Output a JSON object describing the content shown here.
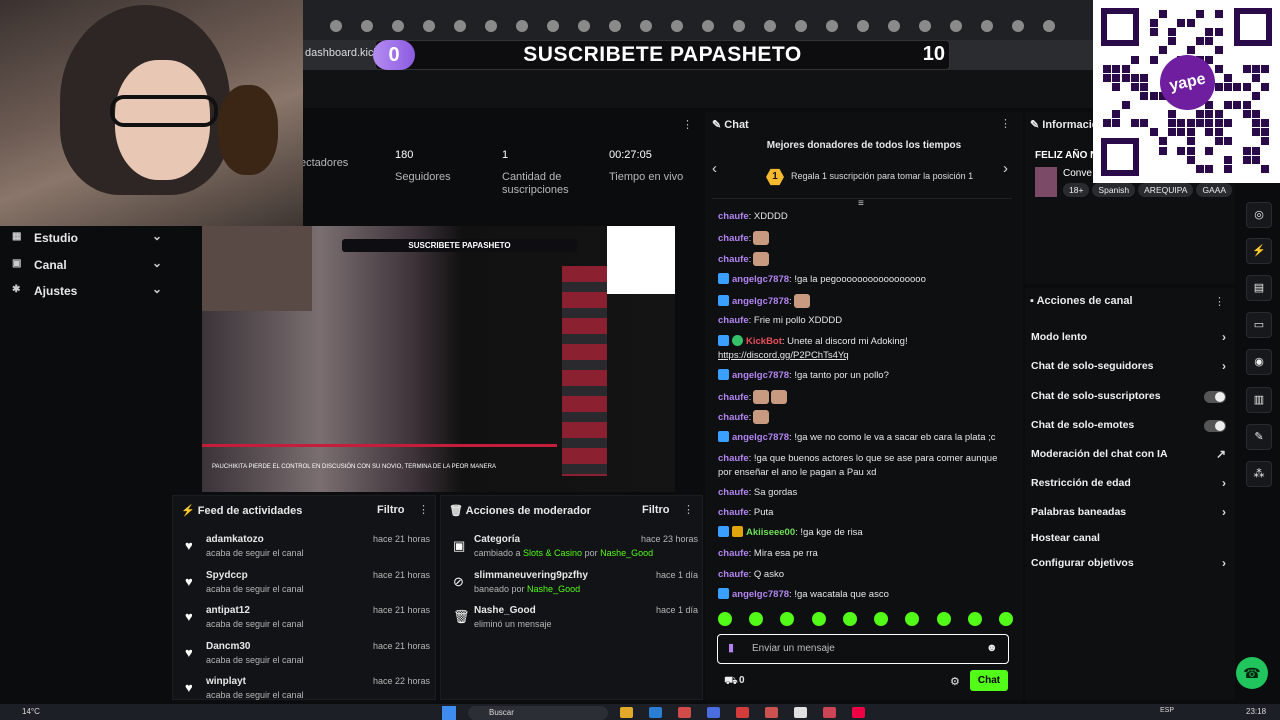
{
  "browser": {
    "url": "dashboard.kick.",
    "banner_count": "0",
    "banner_text": "SUSCRIBETE PAPASHETO",
    "banner_goal": "10"
  },
  "stats": [
    {
      "value": "",
      "label": "ectadores"
    },
    {
      "value": "180",
      "label": "Seguidores"
    },
    {
      "value": "1",
      "label": "Cantidad de suscripciones"
    },
    {
      "value": "00:27:05",
      "label": "Tiempo en vivo"
    }
  ],
  "sidebar": {
    "items": [
      {
        "label": "Estudio"
      },
      {
        "label": "Canal"
      },
      {
        "label": "Ajustes"
      }
    ]
  },
  "player": {
    "mini_banner": "SUSCRIBETE PAPASHETO",
    "caption": "PAUCHIKITA PIERDE EL CONTROL EN DISCUSIÓN CON SU NOVIO, TERMINA DE LA PEOR MANERA"
  },
  "feed": {
    "title": "Feed de actividades",
    "filter": "Filtro",
    "items": [
      {
        "name": "adamkatozo",
        "sub": "acaba de seguir el canal",
        "time": "hace 21 horas"
      },
      {
        "name": "Spydccp",
        "sub": "acaba de seguir el canal",
        "time": "hace 21 horas"
      },
      {
        "name": "antipat12",
        "sub": "acaba de seguir el canal",
        "time": "hace 21 horas"
      },
      {
        "name": "Dancm30",
        "sub": "acaba de seguir el canal",
        "time": "hace 21 horas"
      },
      {
        "name": "winplayt",
        "sub": "acaba de seguir el canal",
        "time": "hace 22 horas"
      }
    ]
  },
  "moderator": {
    "title": "Acciones de moderador",
    "filter": "Filtro",
    "items": [
      {
        "name": "Categoría",
        "sub_prefix": "cambiado a ",
        "sub_hl": "Slots & Casino",
        "sub_mid": " por ",
        "sub_user": "Nashe_Good",
        "time": "hace 23 horas"
      },
      {
        "name": "slimmaneuvering9pzfhy",
        "sub_prefix": "baneado por ",
        "sub_hl": "",
        "sub_mid": "",
        "sub_user": "Nashe_Good",
        "time": "hace 1 día"
      },
      {
        "name": "Nashe_Good",
        "sub_prefix": "eliminó un mensaje",
        "sub_hl": "",
        "sub_mid": "",
        "sub_user": "",
        "time": "hace 1 día"
      }
    ]
  },
  "chat": {
    "title": "Chat",
    "donors_title": "Mejores donadores de todos los tiempos",
    "donor_rank": "1",
    "donor_text": "Regala 1 suscripción para tomar la posición 1",
    "messages": [
      {
        "user": "chaufe",
        "text": ": XDDDD"
      },
      {
        "user": "chaufe",
        "text": ":"
      },
      {
        "user": "chaufe",
        "text": ":"
      },
      {
        "user": "angelgc7878",
        "text": ": !ga la pegooooooooooooooooo"
      },
      {
        "user": "angelgc7878",
        "text": ":"
      },
      {
        "user": "chaufe",
        "text": ": Frie mi pollo XDDDD"
      },
      {
        "user": "KickBot",
        "text": ": Unete al discord mi Adoking!",
        "link": "https://discord.gg/P2PChTs4Yq"
      },
      {
        "user": "angelgc7878",
        "text": ": !ga tanto por un pollo?"
      },
      {
        "user": "chaufe",
        "text": ":"
      },
      {
        "user": "chaufe",
        "text": ":"
      },
      {
        "user": "angelgc7878",
        "text": ": !ga we no como le va a sacar eb cara la plata ;c"
      },
      {
        "user": "chaufe",
        "text": ": !ga que buenos actores lo que se ase para comer aunque por enseñar el ano le pagan a Pau xd"
      },
      {
        "user": "chaufe",
        "text": ": Sa gordas"
      },
      {
        "user": "chaufe",
        "text": ": Puta"
      },
      {
        "user": "Akiiseee00",
        "text": ": !ga kge de risa"
      },
      {
        "user": "chaufe",
        "text": ": Mira esa pe rra"
      },
      {
        "user": "chaufe",
        "text": ": Q asko"
      },
      {
        "user": "angelgc7878",
        "text": ": !ga wacatala que asco"
      }
    ],
    "input_placeholder": "Enviar un mensaje",
    "gift_count": "0",
    "send_label": "Chat"
  },
  "info": {
    "title": "Informació",
    "stream_title": "FELIZ AÑO N",
    "category": "Conve",
    "tags": [
      "18+",
      "Spanish",
      "AREQUIPA",
      "GAAA"
    ]
  },
  "channel_actions": {
    "title": "Acciones de canal",
    "items": [
      {
        "label": "Modo lento",
        "kind": "arrow"
      },
      {
        "label": "Chat de solo-seguidores",
        "kind": "arrow"
      },
      {
        "label": "Chat de solo-suscriptores",
        "kind": "toggle"
      },
      {
        "label": "Chat de solo-emotes",
        "kind": "toggle"
      },
      {
        "label": "Moderación del chat con IA",
        "kind": "external"
      },
      {
        "label": "Restricción de edad",
        "kind": "arrow"
      },
      {
        "label": "Palabras baneadas",
        "kind": "arrow"
      },
      {
        "label": "Hostear canal",
        "kind": "none"
      },
      {
        "label": "Configurar objetivos",
        "kind": "arrow"
      }
    ]
  },
  "overlay": {
    "yape": "yape"
  },
  "taskbar": {
    "weather": "14°C",
    "search": "Buscar",
    "lang": "ESP",
    "clock": "23:18"
  },
  "colors": {
    "accent": "#53fc18",
    "username": "#b285f2",
    "panel": "#121316",
    "background": "#0b0c0e"
  }
}
